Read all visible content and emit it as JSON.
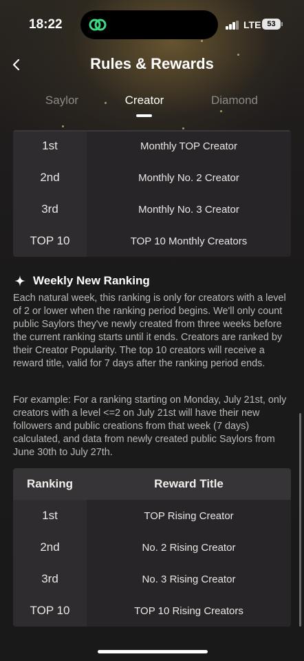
{
  "status": {
    "time": "18:22",
    "network": "LTE",
    "battery": "53"
  },
  "header": {
    "title": "Rules & Rewards"
  },
  "tabs": [
    {
      "label": "Saylor",
      "active": false
    },
    {
      "label": "Creator",
      "active": true
    },
    {
      "label": "Diamond",
      "active": false
    }
  ],
  "monthly_table": {
    "rows": [
      {
        "rank": "1st",
        "reward": "Monthly TOP Creator"
      },
      {
        "rank": "2nd",
        "reward": "Monthly No. 2 Creator"
      },
      {
        "rank": "3rd",
        "reward": "Monthly No. 3 Creator"
      },
      {
        "rank": "TOP 10",
        "reward": "TOP 10 Monthly Creators"
      }
    ]
  },
  "weekly": {
    "title": "Weekly New Ranking",
    "description": "Each natural week, this ranking is only for creators with a level of 2 or lower when the ranking period begins. We'll only count public Saylors they've newly created from three weeks before the current ranking starts until it ends. Creators are ranked by their Creator Popularity. The top 10 creators will receive a reward title, valid for 7 days after the ranking period ends.",
    "example": "For example: For a ranking starting on Monday, July 21st, only creators with a level <=2 on July 21st will have their new followers and public creations from that week (7 days) calculated, and data from newly created public Saylors from June 30th to July 27th."
  },
  "weekly_table": {
    "headers": {
      "rank": "Ranking",
      "reward": "Reward Title"
    },
    "rows": [
      {
        "rank": "1st",
        "reward": "TOP Rising Creator"
      },
      {
        "rank": "2nd",
        "reward": "No. 2 Rising Creator"
      },
      {
        "rank": "3rd",
        "reward": "No. 3 Rising Creator"
      },
      {
        "rank": "TOP 10",
        "reward": "TOP 10 Rising Creators"
      }
    ]
  },
  "colors": {
    "accent_green": "#3ddc84",
    "background": "#1c1a1b"
  }
}
